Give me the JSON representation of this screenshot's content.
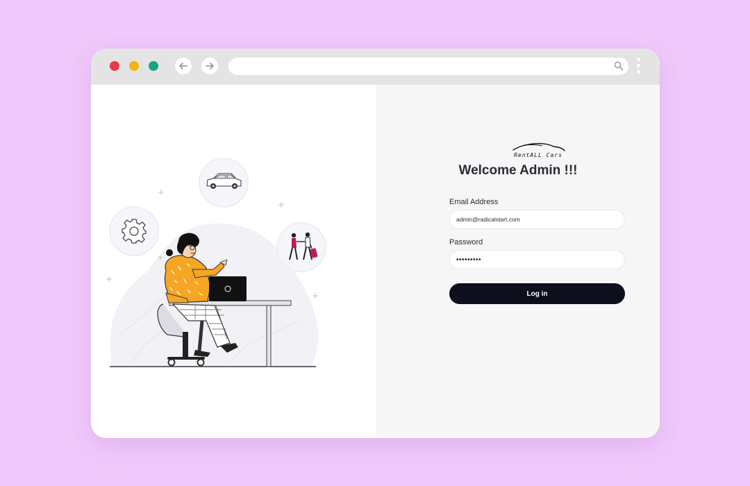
{
  "browser": {
    "traffic_lights": [
      "#e63a4a",
      "#f4b311",
      "#17a583"
    ],
    "icons": {
      "back": "arrow-left-icon",
      "forward": "arrow-right-icon",
      "search": "search-icon",
      "menu": "kebab-menu-icon"
    },
    "url": ""
  },
  "brand": {
    "logo_text": "RentALL Cars"
  },
  "login": {
    "heading": "Welcome Admin !!!",
    "email_label": "Email Address",
    "email_value": "admin@radicalstart.com",
    "password_label": "Password",
    "password_value": "•••••••••",
    "submit_label": "Log in"
  },
  "colors": {
    "page_background": "#f1c8fb",
    "button": "#0d0f1c",
    "accent_illustration": "#f6a623"
  }
}
